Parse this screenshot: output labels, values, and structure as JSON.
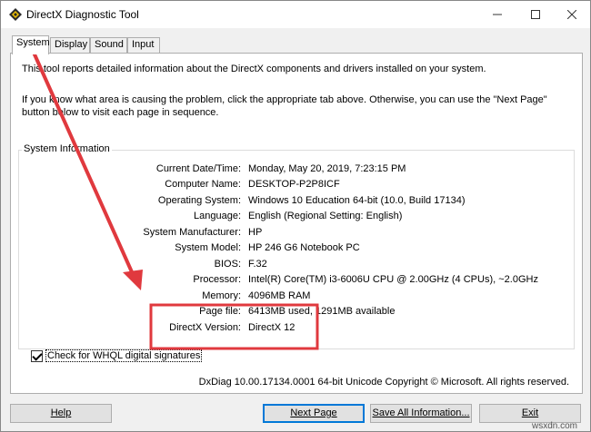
{
  "window": {
    "title": "DirectX Diagnostic Tool"
  },
  "tabs": [
    {
      "label": "System"
    },
    {
      "label": "Display"
    },
    {
      "label": "Sound"
    },
    {
      "label": "Input"
    }
  ],
  "intro": {
    "line1": "This tool reports detailed information about the DirectX components and drivers installed on your system.",
    "line2": "If you know what area is causing the problem, click the appropriate tab above.  Otherwise, you can use the \"Next Page\" button below to visit each page in sequence."
  },
  "system_info": {
    "group_title": "System Information",
    "rows": [
      {
        "label": "Current Date/Time:",
        "value": "Monday, May 20, 2019, 7:23:15 PM"
      },
      {
        "label": "Computer Name:",
        "value": "DESKTOP-P2P8ICF"
      },
      {
        "label": "Operating System:",
        "value": "Windows 10 Education 64-bit (10.0, Build 17134)"
      },
      {
        "label": "Language:",
        "value": "English (Regional Setting: English)"
      },
      {
        "label": "System Manufacturer:",
        "value": "HP"
      },
      {
        "label": "System Model:",
        "value": "HP 246 G6 Notebook PC"
      },
      {
        "label": "BIOS:",
        "value": "F.32"
      },
      {
        "label": "Processor:",
        "value": "Intel(R) Core(TM) i3-6006U CPU @ 2.00GHz (4 CPUs), ~2.0GHz"
      },
      {
        "label": "Memory:",
        "value": "4096MB RAM"
      },
      {
        "label": "Page file:",
        "value": "6413MB used, 1291MB available"
      },
      {
        "label": "DirectX Version:",
        "value": "DirectX 12"
      }
    ]
  },
  "whql": {
    "label": "Check for WHQL digital signatures",
    "checked": true
  },
  "footer": {
    "version": "DxDiag 10.00.17134.0001 64-bit Unicode  Copyright © Microsoft. All rights reserved."
  },
  "buttons": {
    "help": "Help",
    "next": "Next Page",
    "save": "Save All Information...",
    "exit": "Exit"
  },
  "annotation": {
    "color": "#e0393e"
  },
  "watermark": "wsxdn.com"
}
